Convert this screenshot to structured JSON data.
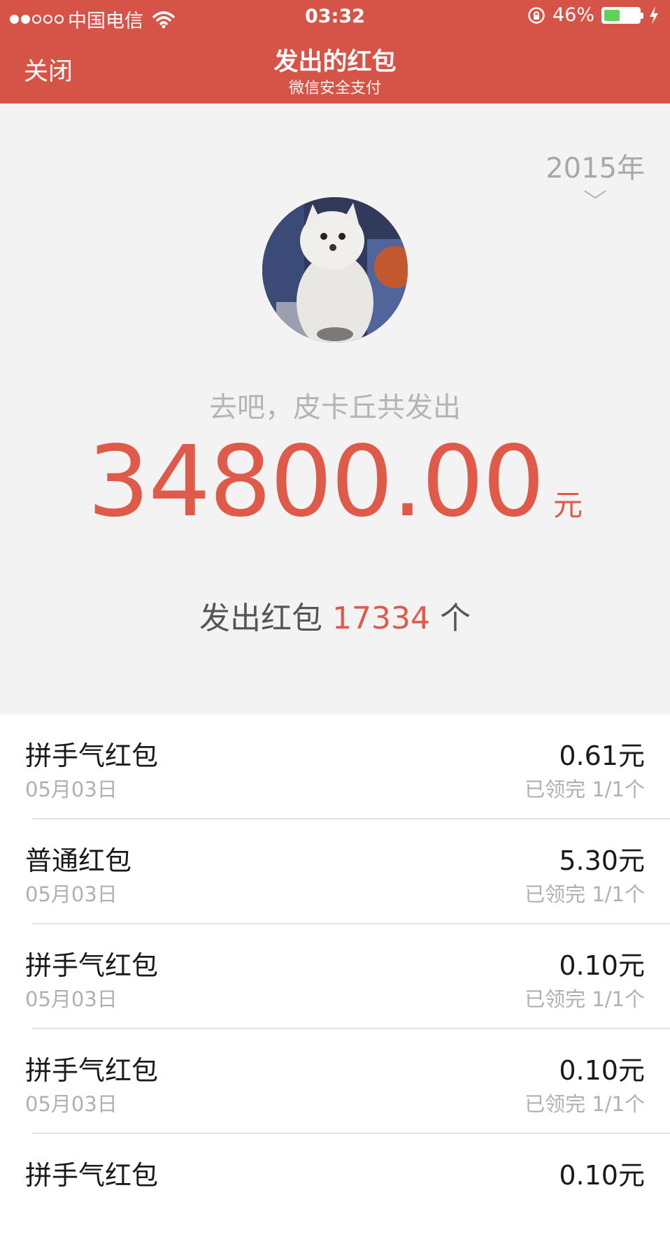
{
  "status_bar": {
    "carrier": "中国电信",
    "signal_bars_filled": 2,
    "signal_bars_total": 5,
    "time": "03:32",
    "battery_percent": "46%",
    "battery_level": 0.46
  },
  "nav": {
    "close_label": "关闭",
    "title": "发出的红包",
    "subtitle": "微信安全支付"
  },
  "summary": {
    "year": "2015年",
    "sender_line": "去吧，皮卡丘共发出",
    "total_amount": "34800.00",
    "amount_unit": "元",
    "count_prefix": "发出红包 ",
    "count_value": "17334",
    "count_suffix": " 个"
  },
  "packets": [
    {
      "type": "拼手气红包",
      "date": "05月03日",
      "amount": "0.61元",
      "status": "已领完 1/1个"
    },
    {
      "type": "普通红包",
      "date": "05月03日",
      "amount": "5.30元",
      "status": "已领完 1/1个"
    },
    {
      "type": "拼手气红包",
      "date": "05月03日",
      "amount": "0.10元",
      "status": "已领完 1/1个"
    },
    {
      "type": "拼手气红包",
      "date": "05月03日",
      "amount": "0.10元",
      "status": "已领完 1/1个"
    },
    {
      "type": "拼手气红包",
      "date": "",
      "amount": "0.10元",
      "status": ""
    }
  ],
  "colors": {
    "brand_red": "#d65447",
    "amount_red": "#e05a4a",
    "battery_green": "#5ed15a"
  }
}
